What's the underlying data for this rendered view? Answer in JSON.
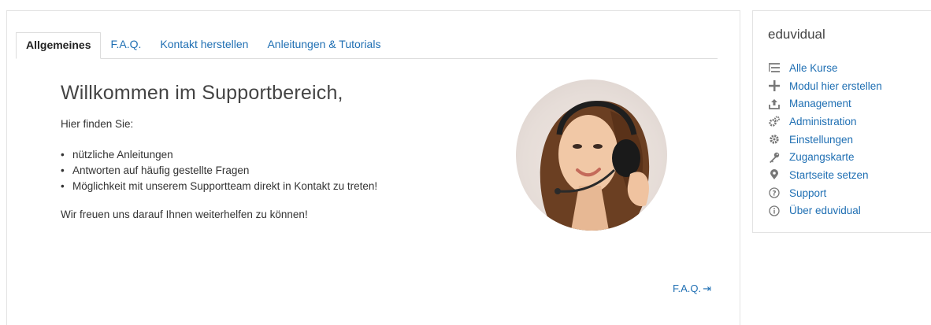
{
  "tabs": [
    {
      "label": "Allgemeines",
      "active": true
    },
    {
      "label": "F.A.Q.",
      "active": false
    },
    {
      "label": "Kontakt herstellen",
      "active": false
    },
    {
      "label": "Anleitungen & Tutorials",
      "active": false
    }
  ],
  "content": {
    "title": "Willkommen im Supportbereich,",
    "intro": "Hier finden Sie:",
    "bullets": [
      "nützliche Anleitungen",
      "Antworten auf häufig gestellte Fragen",
      "Möglichkeit mit unserem Supportteam direkt in Kontakt zu treten!"
    ],
    "closing": "Wir freuen uns darauf Ihnen weiterhelfen zu können!",
    "faq_link": "F.A.Q."
  },
  "sidebar": {
    "title": "eduvidual",
    "items": [
      {
        "label": "Alle Kurse",
        "icon": "list-icon"
      },
      {
        "label": "Modul hier erstellen",
        "icon": "plus-icon"
      },
      {
        "label": "Management",
        "icon": "upload-icon"
      },
      {
        "label": "Administration",
        "icon": "cogs-icon"
      },
      {
        "label": "Einstellungen",
        "icon": "gear-icon"
      },
      {
        "label": "Zugangskarte",
        "icon": "key-icon"
      },
      {
        "label": "Startseite setzen",
        "icon": "map-marker-icon"
      },
      {
        "label": "Support",
        "icon": "question-circle-icon"
      },
      {
        "label": "Über eduvidual",
        "icon": "info-circle-icon"
      }
    ]
  },
  "colors": {
    "link": "#1f6fb3",
    "border": "#dcdcdc",
    "icon": "#777777"
  }
}
